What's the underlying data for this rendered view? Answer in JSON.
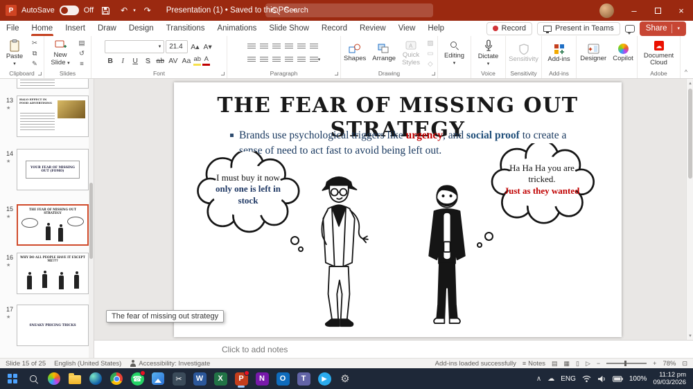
{
  "titlebar": {
    "autosave_label": "AutoSave",
    "autosave_state": "Off",
    "doc_title": "Presentation (1) • Saved to this PC",
    "search_placeholder": "Search"
  },
  "menubar": {
    "tabs": [
      "File",
      "Home",
      "Insert",
      "Draw",
      "Design",
      "Transitions",
      "Animations",
      "Slide Show",
      "Record",
      "Review",
      "View",
      "Help"
    ],
    "record_button": "Record",
    "present_button": "Present in Teams",
    "share_button": "Share"
  },
  "ribbon": {
    "paste_label": "Paste",
    "clipboard_group": "Clipboard",
    "new_slide_label": "New Slide",
    "slides_group": "Slides",
    "font_name_value": "",
    "font_size_value": "21.4",
    "font_group": "Font",
    "paragraph_group": "Paragraph",
    "shapes_label": "Shapes",
    "arrange_label": "Arrange",
    "quick_styles_label": "Quick Styles",
    "drawing_group": "Drawing",
    "editing_label": "Editing",
    "dictate_label": "Dictate",
    "voice_group": "Voice",
    "sensitivity_label": "Sensitivity",
    "sensitivity_group": "Sensitivity",
    "addins_label": "Add-ins",
    "addins_group": "Add-ins",
    "designer_label": "Designer",
    "copilot_label": "Copilot",
    "document_cloud_label": "Document Cloud",
    "adobe_group": "Adobe",
    "font_buttons": {
      "bold": "B",
      "italic": "I",
      "underline": "U",
      "shadow": "S",
      "strike": "ab",
      "spacing": "AV",
      "case": "Aa"
    }
  },
  "slide_panel": {
    "thumbnails": [
      {
        "number": "13",
        "title": "HALO EFFECT IN FOOD ADVERTISING"
      },
      {
        "number": "14",
        "title": "YOUR FEAR OF MISSING OUT (FOMO)"
      },
      {
        "number": "15",
        "title": "THE FEAR OF MISSING OUT STRATEGY"
      },
      {
        "number": "16",
        "title": "WHY DO ALL PEOPLE HAVE IT EXCEPT ME???"
      },
      {
        "number": "17",
        "title": "SNEAKY PRICING TRICKS"
      }
    ],
    "tooltip": "The fear of missing out strategy"
  },
  "slide": {
    "title": "THE FEAR OF MISSING OUT STRATEGY",
    "bullet": {
      "seg1": "Brands use psychological triggers like ",
      "seg2": "urgency",
      "seg3": ", and ",
      "seg4": "social proof",
      "seg5": " to create a sense of need to act fast to avoid being left out."
    },
    "left_bubble": {
      "line1": "I must buy it now",
      "line2": "only one is left in stock"
    },
    "right_bubble": {
      "line1": "Ha Ha Ha you are tricked.",
      "line2": "Just as they wanted"
    },
    "colors": {
      "urgency_red": "#C00000",
      "social_proof_blue": "#1F4E79",
      "body_text": "#17375E"
    }
  },
  "notes": {
    "placeholder": "Click to add notes"
  },
  "statusbar": {
    "slide_indicator": "Slide 15 of 25",
    "language": "English (United States)",
    "accessibility": "Accessibility: Investigate",
    "addins_status": "Add-ins loaded successfully",
    "notes_label": "Notes",
    "zoom_level": "78%"
  },
  "taskbar": {
    "icons": [
      {
        "name": "start",
        "glyph": ""
      },
      {
        "name": "search",
        "glyph": ""
      },
      {
        "name": "copilot",
        "glyph": ""
      },
      {
        "name": "file-explorer",
        "glyph": ""
      },
      {
        "name": "edge",
        "glyph": ""
      },
      {
        "name": "chrome",
        "glyph": ""
      },
      {
        "name": "whatsapp",
        "glyph": "☎"
      },
      {
        "name": "photos",
        "glyph": ""
      },
      {
        "name": "snipping-tool",
        "glyph": "✂"
      },
      {
        "name": "word",
        "glyph": "W"
      },
      {
        "name": "excel",
        "glyph": "X"
      },
      {
        "name": "powerpoint",
        "glyph": "P"
      },
      {
        "name": "onenote",
        "glyph": "N"
      },
      {
        "name": "outlook",
        "glyph": "O"
      },
      {
        "name": "teams",
        "glyph": "T"
      },
      {
        "name": "telegram",
        "glyph": "▶"
      },
      {
        "name": "settings",
        "glyph": "⚙"
      }
    ],
    "tray": {
      "language": "ENG",
      "battery": "100%",
      "time": "11:12 pm",
      "date": "09/03/2026"
    }
  },
  "icons": {
    "caret_down": "▾",
    "caret_up": "▴",
    "save": "",
    "undo": "↶",
    "redo": "↷",
    "cut": "✂",
    "copy": "⧉",
    "format_painter": "✎",
    "layout": "▤",
    "reset": "↺",
    "section": "≡",
    "increase_font": "A▴",
    "decrease_font": "A▾",
    "star": "★",
    "cloud": "☁",
    "chevron_up": "∧",
    "view_normal": "▤",
    "view_sorter": "▦",
    "view_reading": "▯",
    "view_slideshow": "▷",
    "zoom_minus": "−",
    "zoom_plus": "+",
    "fit_window": "⊡",
    "fill": "▨",
    "outline": "▭",
    "effects": "◇",
    "minimize": "–",
    "close": "×"
  }
}
